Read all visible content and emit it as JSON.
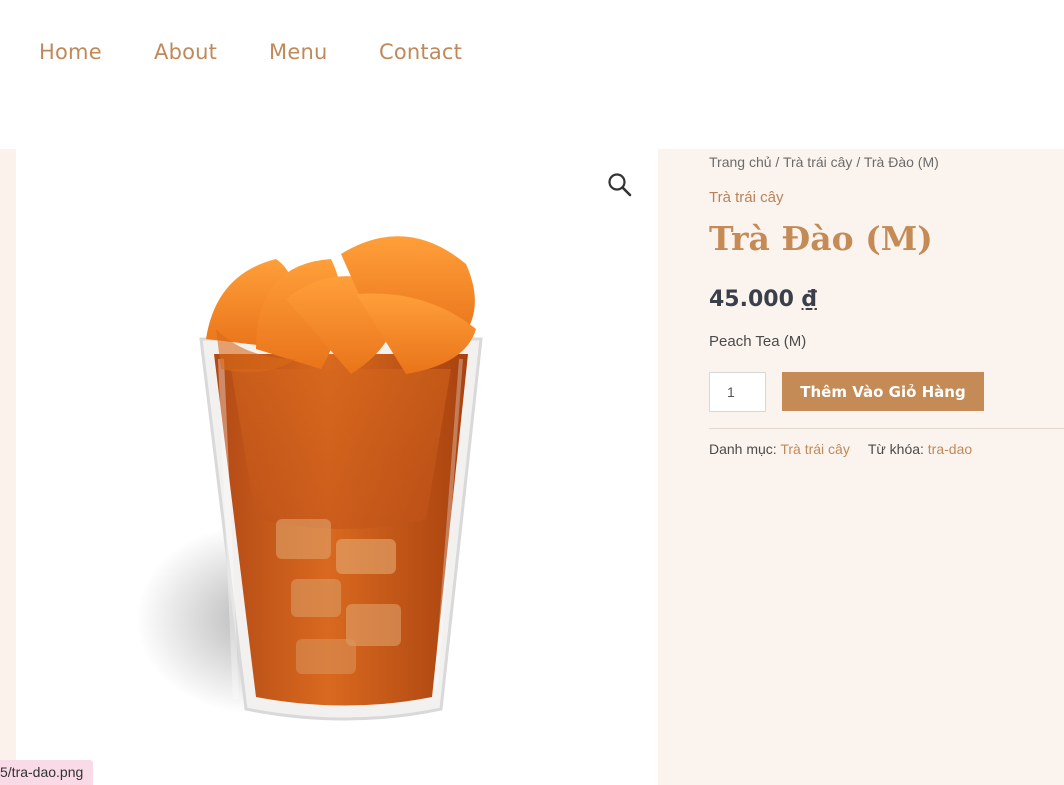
{
  "nav": {
    "items": [
      {
        "label": "Home"
      },
      {
        "label": "About"
      },
      {
        "label": "Menu"
      },
      {
        "label": "Contact"
      }
    ]
  },
  "gallery": {
    "zoom_icon": "magnifier-icon",
    "product_image": "peach-tea-cup-image"
  },
  "breadcrumb": {
    "items": [
      "Trang chủ",
      "Trà trái cây",
      "Trà Đào (M)"
    ],
    "separator": " / "
  },
  "product": {
    "category": "Trà trái cây",
    "title": "Trà Đào (M)",
    "price_value": "45.000",
    "currency": "₫",
    "description": "Peach Tea (M)",
    "quantity": "1",
    "add_to_cart_label": "Thêm Vào Giỏ Hàng"
  },
  "meta": {
    "category_label": "Danh mục:",
    "category_value": "Trà trái cây",
    "tag_label": "Từ khóa:",
    "tag_value": "tra-dao"
  },
  "status_bar": {
    "url": "5/tra-dao.png"
  },
  "colors": {
    "accent": "#c58b56",
    "nav_text": "#c0895a",
    "summary_bg": "#fbf4ee",
    "status_bg": "#f9dbe7"
  }
}
